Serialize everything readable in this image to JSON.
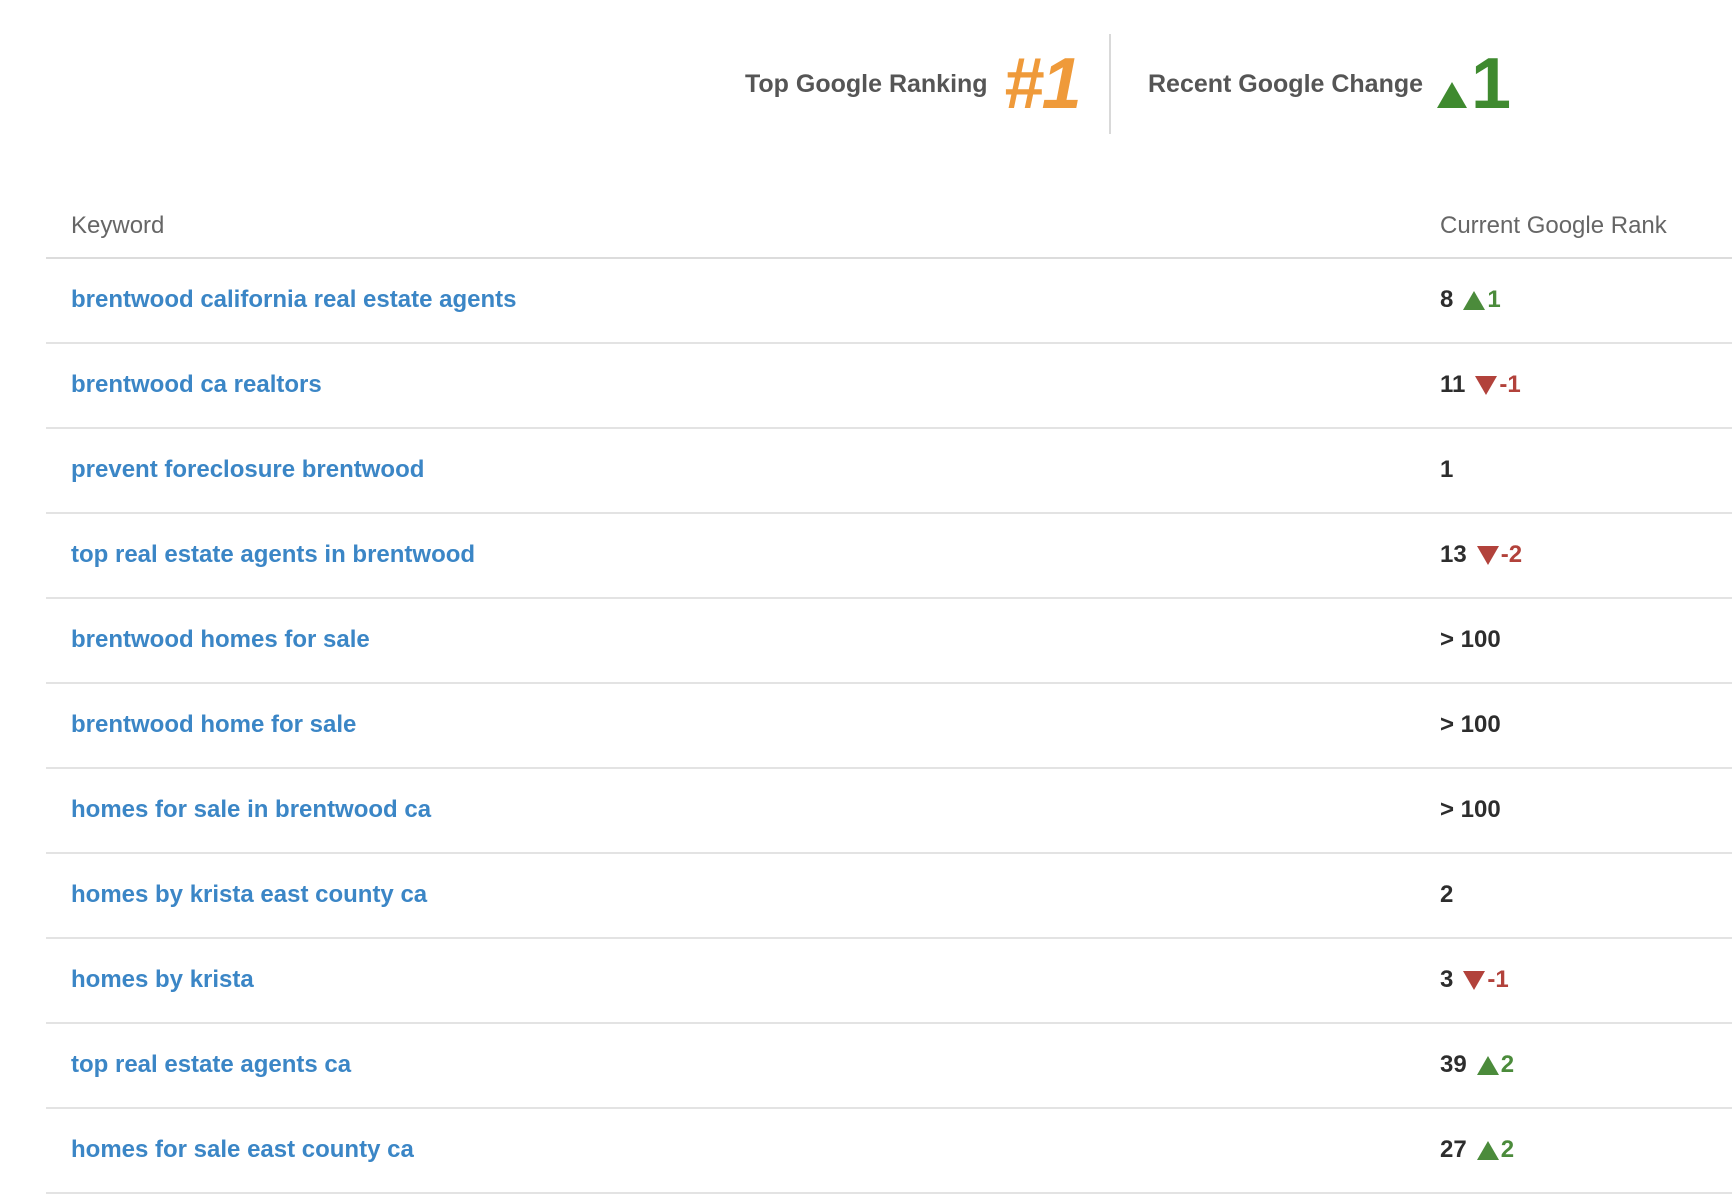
{
  "summary": {
    "top_ranking_label": "Top Google Ranking",
    "top_ranking_value": "#1",
    "recent_change_label": "Recent Google Change",
    "recent_change_value": "1",
    "recent_change_direction": "up"
  },
  "table": {
    "columns": {
      "keyword": "Keyword",
      "rank": "Current Google Rank"
    },
    "rows": [
      {
        "keyword": "brentwood california real estate agents",
        "rank": "8",
        "change": "1",
        "direction": "up"
      },
      {
        "keyword": "brentwood ca realtors",
        "rank": "11",
        "change": "-1",
        "direction": "down"
      },
      {
        "keyword": "prevent foreclosure brentwood",
        "rank": "1",
        "change": "",
        "direction": "none"
      },
      {
        "keyword": "top real estate agents in brentwood",
        "rank": "13",
        "change": "-2",
        "direction": "down"
      },
      {
        "keyword": "brentwood homes for sale",
        "rank": "> 100",
        "change": "",
        "direction": "none"
      },
      {
        "keyword": "brentwood home for sale",
        "rank": "> 100",
        "change": "",
        "direction": "none"
      },
      {
        "keyword": "homes for sale in brentwood ca",
        "rank": "> 100",
        "change": "",
        "direction": "none"
      },
      {
        "keyword": "homes by krista east county ca",
        "rank": "2",
        "change": "",
        "direction": "none"
      },
      {
        "keyword": "homes by krista",
        "rank": "3",
        "change": "-1",
        "direction": "down"
      },
      {
        "keyword": "top real estate agents ca",
        "rank": "39",
        "change": "2",
        "direction": "up"
      },
      {
        "keyword": "homes for sale east county ca",
        "rank": "27",
        "change": "2",
        "direction": "up"
      }
    ]
  },
  "colors": {
    "keyword_link": "#3b86c6",
    "top_rank_accent": "#ef9a3a",
    "change_up": "#4b8b3b",
    "change_down": "#b2423b"
  },
  "icons": {
    "up": "triangle-up-icon",
    "down": "triangle-down-icon"
  }
}
